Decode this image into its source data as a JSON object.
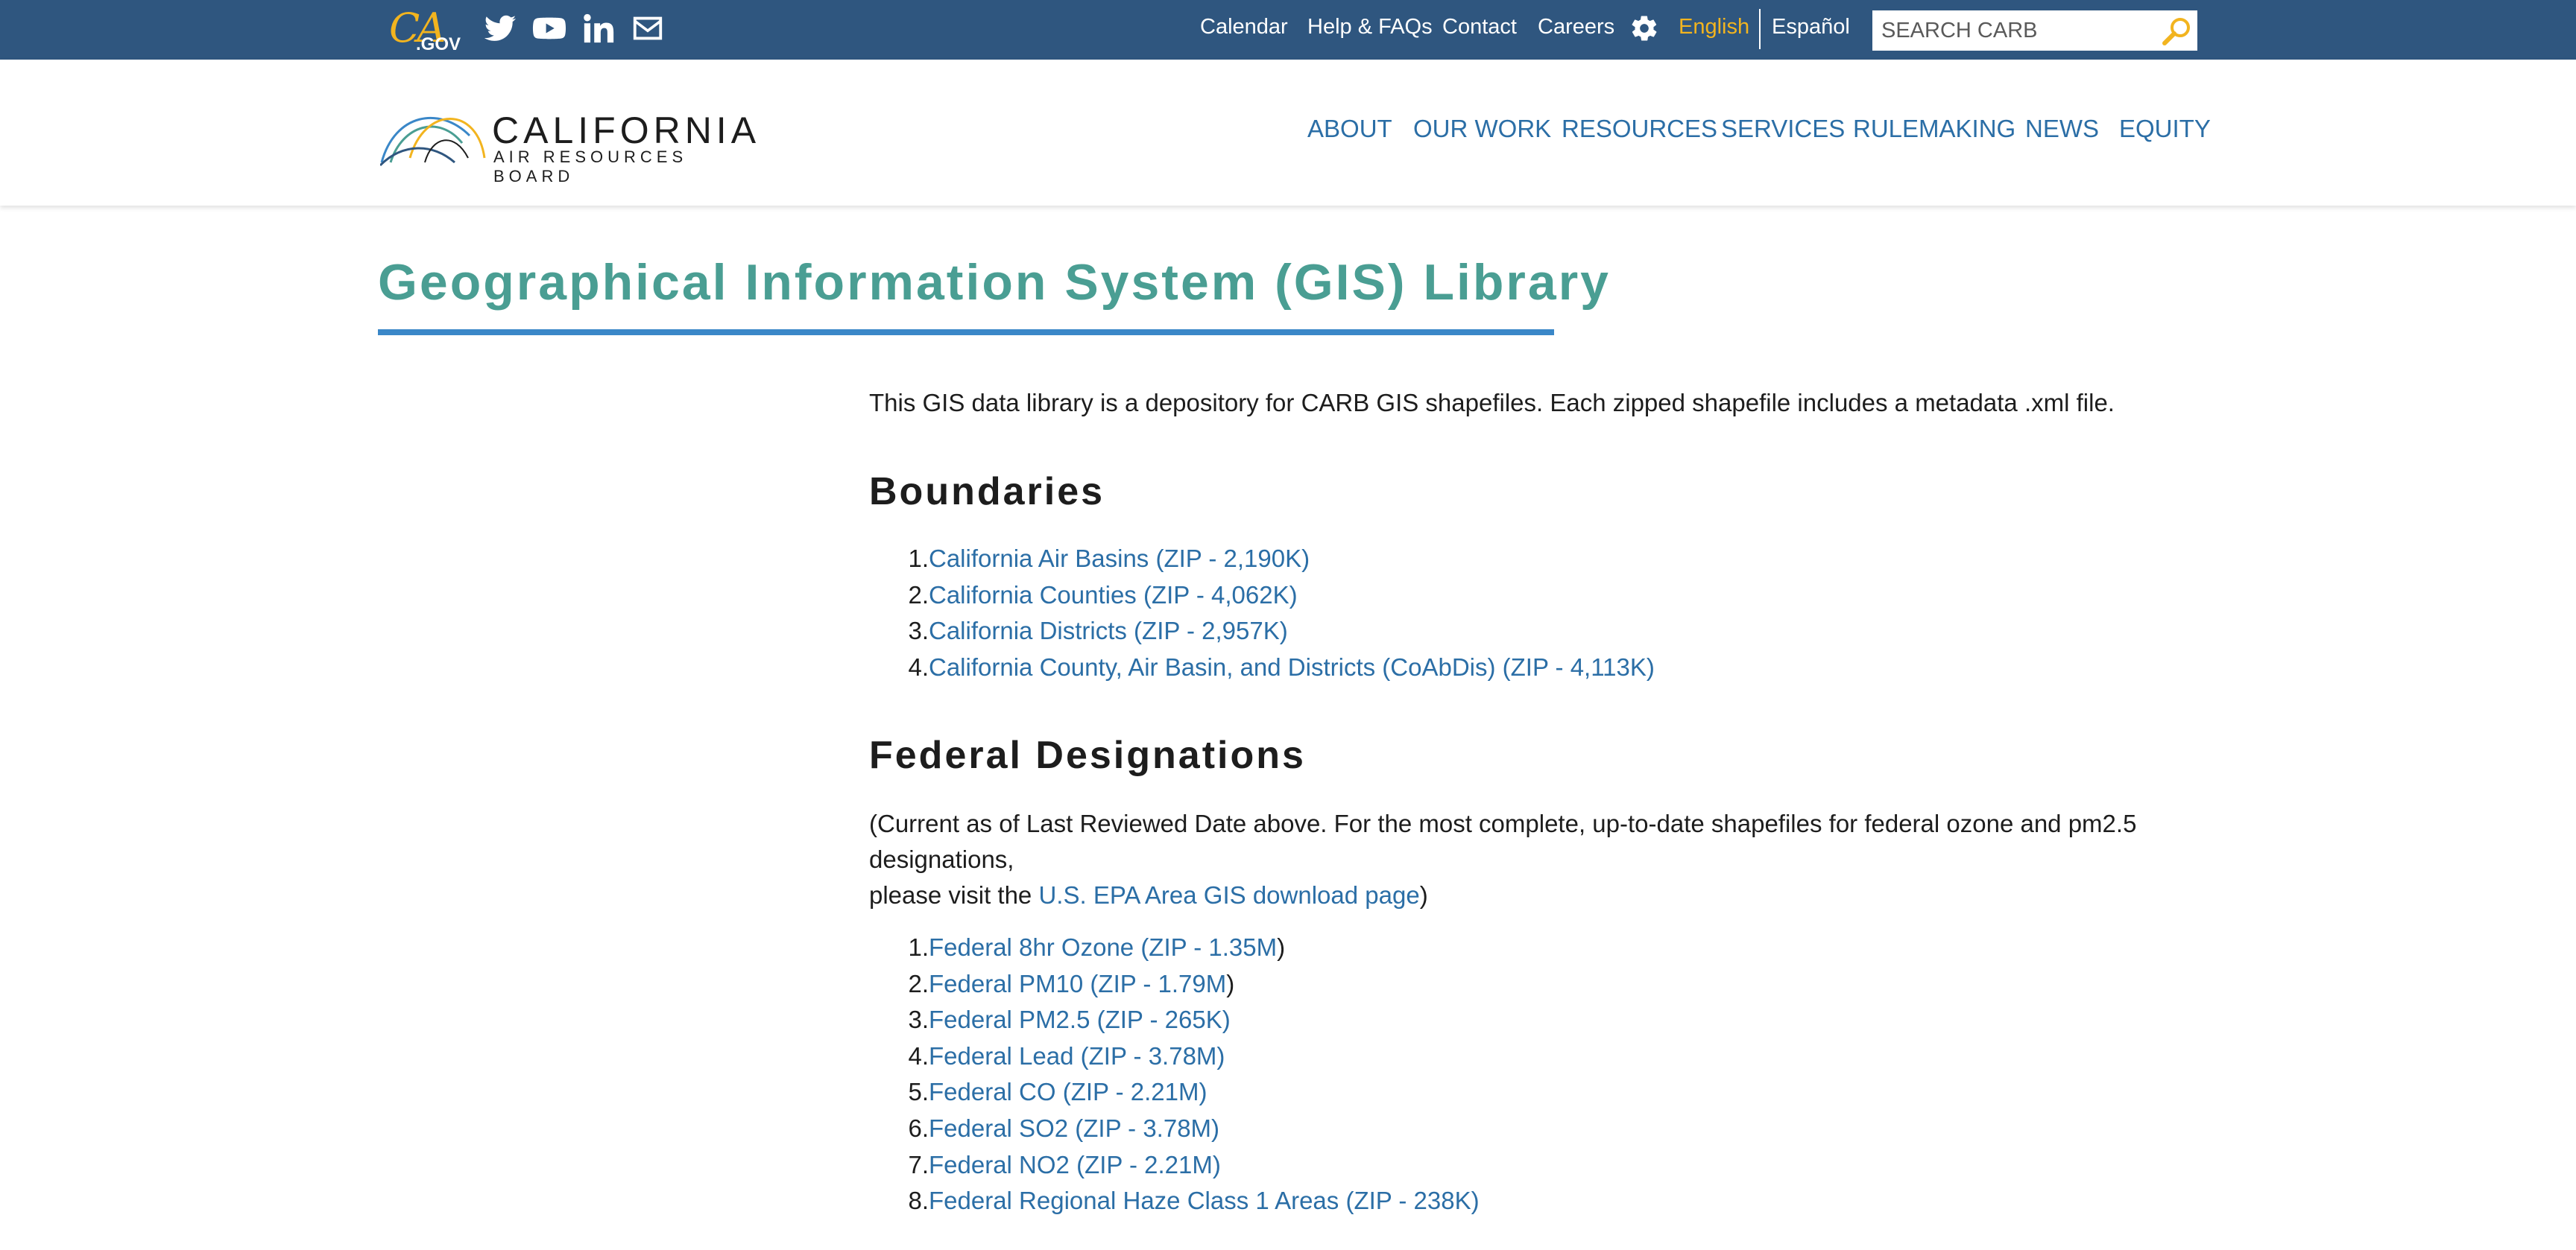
{
  "utility": {
    "logo": {
      "ca": "CA",
      "gov": ".GOV"
    },
    "social": [
      "twitter-icon",
      "youtube-icon",
      "linkedin-icon",
      "email-icon"
    ],
    "links": [
      "Calendar",
      "Help & FAQs",
      "Contact",
      "Careers"
    ],
    "lang_english": "English",
    "lang_espanol": "Español",
    "search_placeholder": "SEARCH CARB"
  },
  "header": {
    "logo_line1": "CALIFORNIA",
    "logo_line2": "AIR RESOURCES BOARD",
    "nav": [
      "ABOUT",
      "OUR WORK",
      "RESOURCES",
      "SERVICES",
      "RULEMAKING",
      "NEWS",
      "EQUITY"
    ]
  },
  "main": {
    "title": "Geographical Information System (GIS) Library",
    "intro": "This GIS data library is a depository for CARB GIS shapefiles. Each zipped shapefile includes a metadata .xml file.",
    "boundaries": {
      "heading": "Boundaries",
      "items": [
        "California Air Basins (ZIP - 2,190K)",
        "California Counties (ZIP - 4,062K)",
        "California Districts (ZIP - 2,957K)",
        "California County, Air Basin, and Districts (CoAbDis) (ZIP - 4,113K)"
      ]
    },
    "federal": {
      "heading": "Federal Designations",
      "note_line1": "(Current as of Last Reviewed Date above.  For the most complete, up-to-date shapefiles for federal ozone and pm2.5",
      "note_line2": "designations,",
      "note_line3_prefix": "please visit the ",
      "note_link": "U.S. EPA Area GIS download page",
      "note_line3_suffix": ")",
      "items": [
        {
          "label": "Federal 8hr Ozone (ZIP - 1.35M",
          "tail": ")"
        },
        {
          "label": "Federal PM10 (ZIP - 1.79M",
          "tail": ")"
        },
        {
          "label": "Federal PM2.5 (ZIP - 265K)",
          "tail": ""
        },
        {
          "label": "Federal Lead (ZIP - 3.78M)",
          "tail": ""
        },
        {
          "label": "Federal CO (ZIP - 2.21M)",
          "tail": ""
        },
        {
          "label": "Federal SO2 (ZIP - 3.78M)",
          "tail": ""
        },
        {
          "label": "Federal NO2 (ZIP - 2.21M)",
          "tail": ""
        },
        {
          "label": "Federal Regional Haze Class 1 Areas (ZIP - 238K)",
          "tail": ""
        }
      ]
    }
  },
  "colors": {
    "utility_bar": "#2f567f",
    "accent_gold": "#f2b41f",
    "link_blue": "#2b6ea6",
    "title_teal": "#4a9e93",
    "rule_blue": "#3a87c8"
  }
}
